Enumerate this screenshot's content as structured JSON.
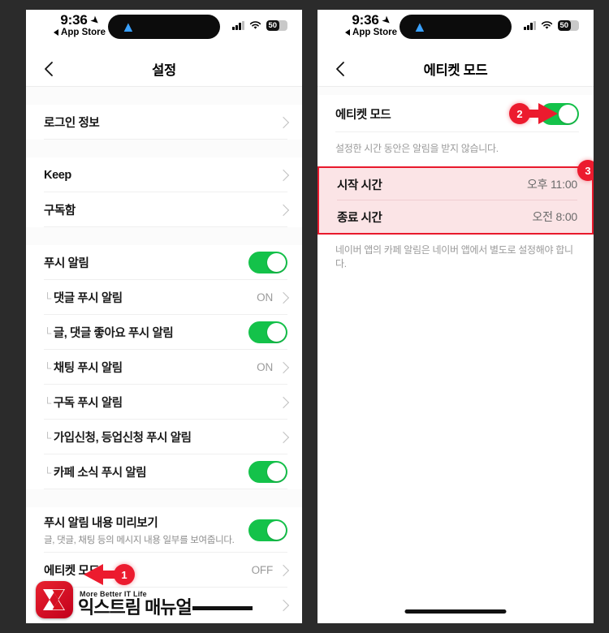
{
  "statusbar": {
    "time": "9:36",
    "back_app": "App Store",
    "battery_text": "50",
    "location_icon": "location-arrow-icon",
    "cellular_icon": "cellular-bars-icon",
    "wifi_icon": "wifi-icon",
    "battery_icon": "battery-icon",
    "island_icon": "navigation-arrow-icon"
  },
  "left": {
    "nav": {
      "back_icon": "chevron-left-icon",
      "title": "설정"
    },
    "groups": [
      {
        "rows": [
          {
            "label": "로그인 정보",
            "type": "chevron"
          }
        ]
      },
      {
        "rows": [
          {
            "label": "Keep",
            "type": "chevron"
          },
          {
            "label": "구독함",
            "type": "chevron"
          }
        ]
      },
      {
        "rows": [
          {
            "label": "푸시 알림",
            "type": "toggle",
            "on": true
          },
          {
            "label": "댓글 푸시 알림",
            "type": "value-chevron",
            "value": "ON",
            "indent": true
          },
          {
            "label": "글, 댓글 좋아요 푸시 알림",
            "type": "toggle",
            "on": true,
            "indent": true
          },
          {
            "label": "채팅 푸시 알림",
            "type": "value-chevron",
            "value": "ON",
            "indent": true
          },
          {
            "label": "구독 푸시 알림",
            "type": "chevron",
            "indent": true
          },
          {
            "label": "가입신청, 등업신청 푸시 알림",
            "type": "chevron",
            "indent": true
          },
          {
            "label": "카페 소식 푸시 알림",
            "type": "toggle",
            "on": true,
            "indent": true
          }
        ]
      },
      {
        "rows": [
          {
            "label": "푸시 알림 내용 미리보기",
            "desc": "글, 댓글, 채팅 등의 메시지 내용 일부를 보여줍니다.",
            "type": "toggle",
            "on": true
          },
          {
            "label": "에티켓 모드",
            "type": "value-chevron",
            "value": "OFF"
          },
          {
            "label": "",
            "type": "chevron"
          }
        ]
      }
    ]
  },
  "right": {
    "nav": {
      "back_icon": "chevron-left-icon",
      "title": "에티켓 모드"
    },
    "master": {
      "label": "에티켓 모드",
      "on": true
    },
    "description": "설정한 시간 동안은 알림을 받지 않습니다.",
    "time_rows": [
      {
        "label": "시작 시간",
        "value": "오후 11:00"
      },
      {
        "label": "종료 시간",
        "value": "오전 8:00"
      }
    ],
    "footnote": "네이버 앱의 카페 알림은 네이버 앱에서 별도로 설정해야 합니다."
  },
  "annotations": [
    {
      "id": "1",
      "label": "1",
      "arrow": "left"
    },
    {
      "id": "2",
      "label": "2",
      "arrow": "right"
    },
    {
      "id": "3",
      "label": "3",
      "arrow": "none"
    }
  ],
  "watermark": {
    "tagline": "More Better IT Life",
    "name": "익스트림 매뉴얼",
    "logo_icon": "extreme-manual-logo-icon"
  },
  "colors": {
    "accent_green": "#14c24a",
    "annotation_red": "#ec1b2e",
    "highlight_bg": "#fbe4e6",
    "page_bg": "#2b2b2b"
  }
}
